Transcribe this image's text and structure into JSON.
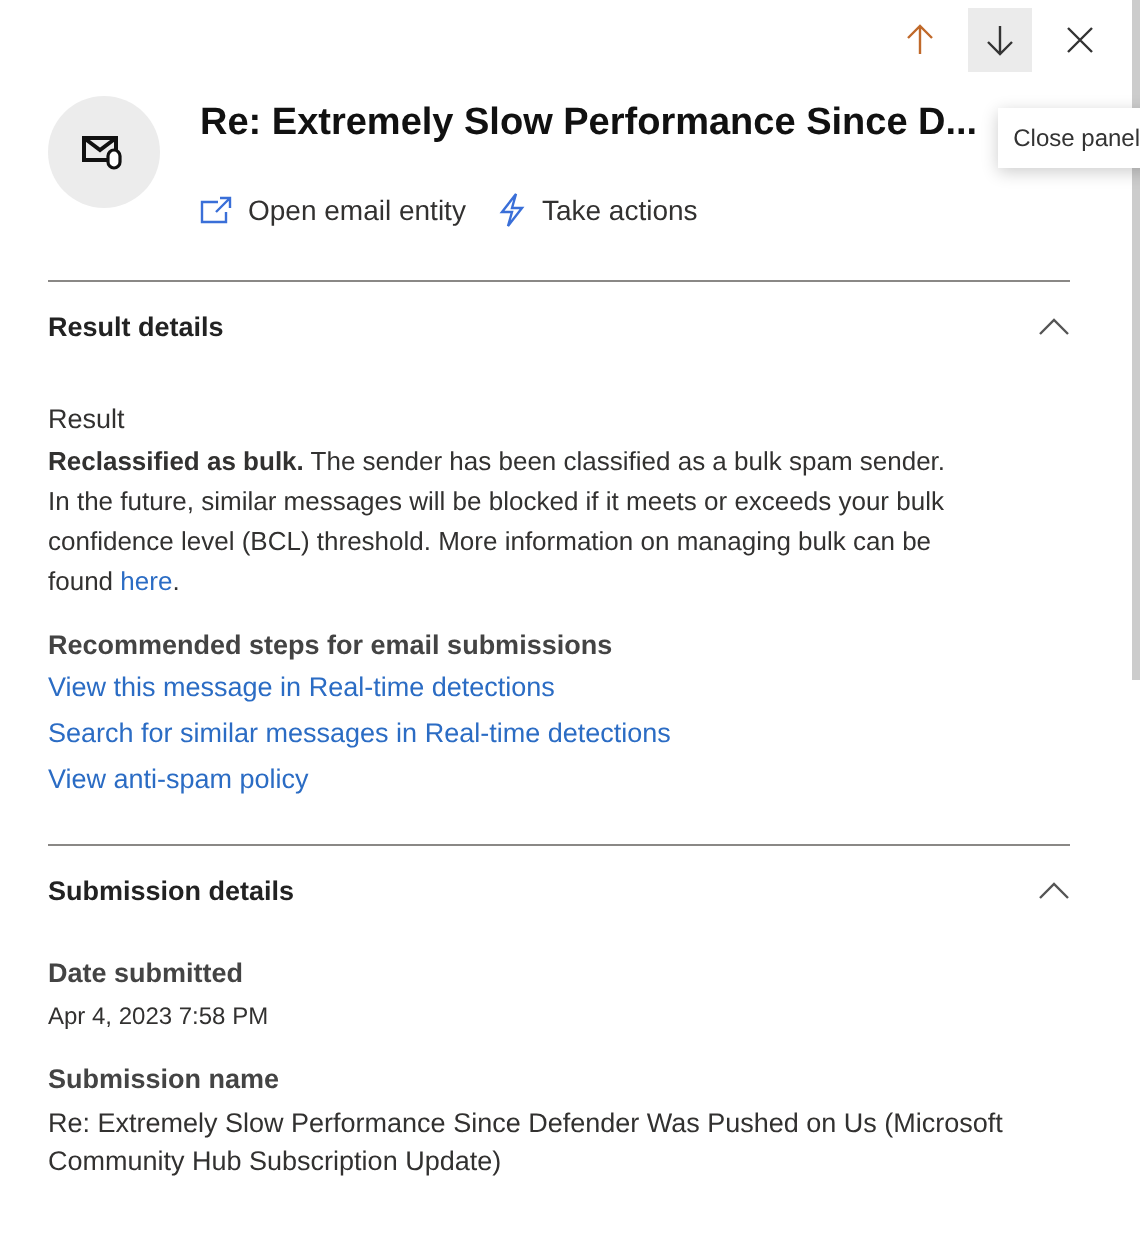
{
  "nav_buttons": [
    {
      "kind": "up",
      "highlighted": false
    },
    {
      "kind": "down",
      "highlighted": true
    },
    {
      "kind": "close",
      "highlighted": false
    }
  ],
  "tooltip": "Close panel",
  "title": "Re: Extremely Slow Performance Since D...",
  "actions": [
    {
      "kind": "open",
      "label": "Open email entity"
    },
    {
      "kind": "bolt",
      "label": "Take actions"
    }
  ],
  "result_section": {
    "title": "Result details",
    "expanded": true,
    "label": "Result",
    "text": "**Reclassified as bulk.** The sender has been classified as a bulk spam sender. In the future, similar messages will be blocked if it meets or exceeds your bulk confidence level (BCL) threshold. More information on managing bulk can be found ",
    "link": "here",
    "text_end": ".",
    "steps_heading": "Recommended steps for email submissions",
    "links": [
      "View this message in Real-time detections",
      "Search for similar messages in Real-time detections",
      "View anti-spam policy"
    ]
  },
  "submission_section": {
    "title": "Submission details",
    "expanded": true,
    "fields": [
      {
        "label": "Date submitted",
        "value": "Apr 4, 2023 7:58 PM",
        "kind": "small"
      },
      {
        "label": "Submission name",
        "value": "Re: Extremely Slow Performance Since Defender Was Pushed on Us (Microsoft Community Hub Subscription Update)",
        "kind": "normal"
      }
    ]
  }
}
